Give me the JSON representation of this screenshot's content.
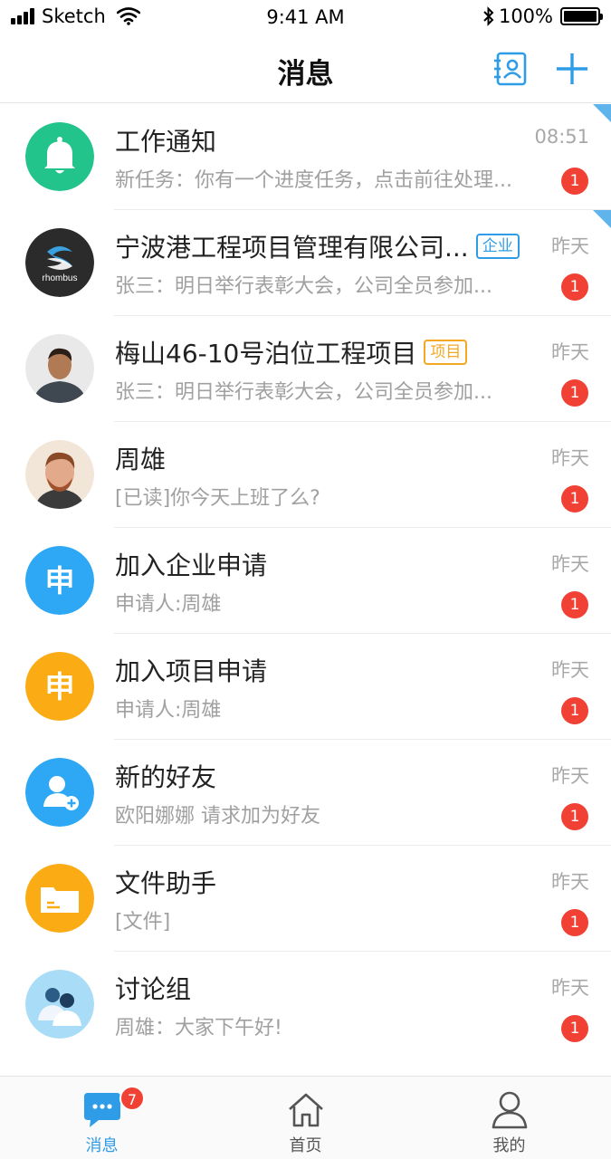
{
  "status_bar": {
    "carrier": "Sketch",
    "time": "9:41 AM",
    "battery": "100%"
  },
  "nav": {
    "title": "消息"
  },
  "messages": [
    {
      "title": "工作通知",
      "tag": "",
      "preview": "新任务：你有一个进度任务，点击前往处理...",
      "time": "08:51",
      "badge": "1",
      "pinned": true,
      "avatar": "bell-icon",
      "avatar_color": "#22c48c"
    },
    {
      "title": "宁波港工程项目管理有限公司...",
      "tag": "企业",
      "preview": "张三：明日举行表彰大会，公司全员参加...",
      "time": "昨天",
      "badge": "1",
      "pinned": true,
      "avatar": "rhombus-logo",
      "avatar_color": "#2b2b2b",
      "logo_text": "rhombus"
    },
    {
      "title": "梅山46-10号泊位工程项目",
      "tag": "项目",
      "preview": "张三：明日举行表彰大会，公司全员参加...",
      "time": "昨天",
      "badge": "1",
      "pinned": false,
      "avatar": "user-photo",
      "avatar_color": "#d9d9d9"
    },
    {
      "title": "周雄",
      "tag": "",
      "preview": "[已读]你今天上班了么?",
      "time": "昨天",
      "badge": "1",
      "pinned": false,
      "avatar": "user-photo",
      "avatar_color": "#f2e6d8"
    },
    {
      "title": "加入企业申请",
      "tag": "",
      "preview": "申请人:周雄",
      "time": "昨天",
      "badge": "1",
      "pinned": false,
      "avatar": "apply-icon",
      "avatar_color": "#2ea8f4",
      "avatar_text": "申"
    },
    {
      "title": "加入项目申请",
      "tag": "",
      "preview": "申请人:周雄",
      "time": "昨天",
      "badge": "1",
      "pinned": false,
      "avatar": "apply-icon",
      "avatar_color": "#fbac14",
      "avatar_text": "申"
    },
    {
      "title": "新的好友",
      "tag": "",
      "preview": "欧阳娜娜 请求加为好友",
      "time": "昨天",
      "badge": "1",
      "pinned": false,
      "avatar": "add-friend-icon",
      "avatar_color": "#2ea8f4"
    },
    {
      "title": "文件助手",
      "tag": "",
      "preview": "[文件]",
      "time": "昨天",
      "badge": "1",
      "pinned": false,
      "avatar": "folder-icon",
      "avatar_color": "#fbac14"
    },
    {
      "title": "讨论组",
      "tag": "",
      "preview": "周雄：大家下午好!",
      "time": "昨天",
      "badge": "1",
      "pinned": false,
      "avatar": "group-icon",
      "avatar_color": "#a9dcf6"
    }
  ],
  "tabs": [
    {
      "label": "消息",
      "icon": "chat-icon",
      "badge": "7",
      "active": true
    },
    {
      "label": "首页",
      "icon": "home-icon",
      "badge": "",
      "active": false
    },
    {
      "label": "我的",
      "icon": "person-icon",
      "badge": "",
      "active": false
    }
  ],
  "colors": {
    "accent": "#2f9ce8",
    "badge": "#f04134",
    "project_tag": "#f5a623"
  }
}
